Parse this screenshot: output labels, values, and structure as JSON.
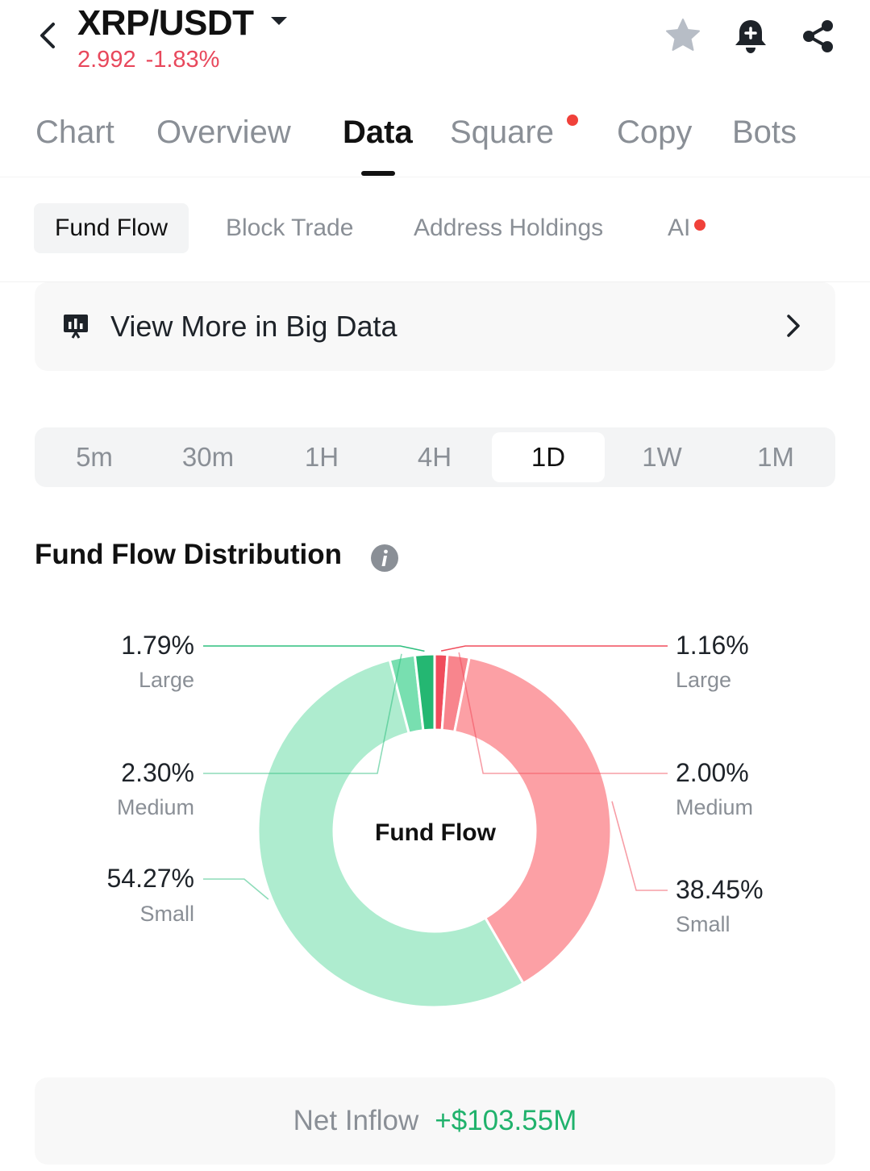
{
  "header": {
    "pair": "XRP/USDT",
    "price": "2.992",
    "change": "-1.83%"
  },
  "main_tabs": [
    {
      "label": "Chart",
      "active": false,
      "badge": false
    },
    {
      "label": "Overview",
      "active": false,
      "badge": false
    },
    {
      "label": "Data",
      "active": true,
      "badge": false
    },
    {
      "label": "Square",
      "active": false,
      "badge": true
    },
    {
      "label": "Copy",
      "active": false,
      "badge": false
    },
    {
      "label": "Bots",
      "active": false,
      "badge": false
    }
  ],
  "sub_tabs": [
    {
      "label": "Fund Flow",
      "active": true
    },
    {
      "label": "Block Trade",
      "active": false
    },
    {
      "label": "Address Holdings",
      "active": false
    },
    {
      "label": "AI",
      "active": false,
      "badge": true
    }
  ],
  "bigdata": {
    "label": "View More in Big Data"
  },
  "timeframes": {
    "options": [
      "5m",
      "30m",
      "1H",
      "4H",
      "1D",
      "1W",
      "1M"
    ],
    "selected": "1D"
  },
  "section": {
    "title": "Fund Flow Distribution"
  },
  "chart_data": {
    "type": "pie",
    "center_label": "Fund Flow",
    "inflow_color": "#aeeccf",
    "outflow_color": "#fca0a5",
    "slices": [
      {
        "side": "outflow",
        "category": "Large",
        "percent": "1.16%",
        "value": 1.16,
        "color": "#f04d5c"
      },
      {
        "side": "outflow",
        "category": "Medium",
        "percent": "2.00%",
        "value": 2.0,
        "color": "#f8858d"
      },
      {
        "side": "outflow",
        "category": "Small",
        "percent": "38.45%",
        "value": 38.45,
        "color": "#fca0a5"
      },
      {
        "side": "inflow",
        "category": "Small",
        "percent": "54.27%",
        "value": 54.27,
        "color": "#aeeccf"
      },
      {
        "side": "inflow",
        "category": "Medium",
        "percent": "2.30%",
        "value": 2.3,
        "color": "#78dfb0"
      },
      {
        "side": "inflow",
        "category": "Large",
        "percent": "1.79%",
        "value": 1.79,
        "color": "#24b772"
      }
    ]
  },
  "net_inflow": {
    "label": "Net Inflow",
    "value": "+$103.55M"
  }
}
